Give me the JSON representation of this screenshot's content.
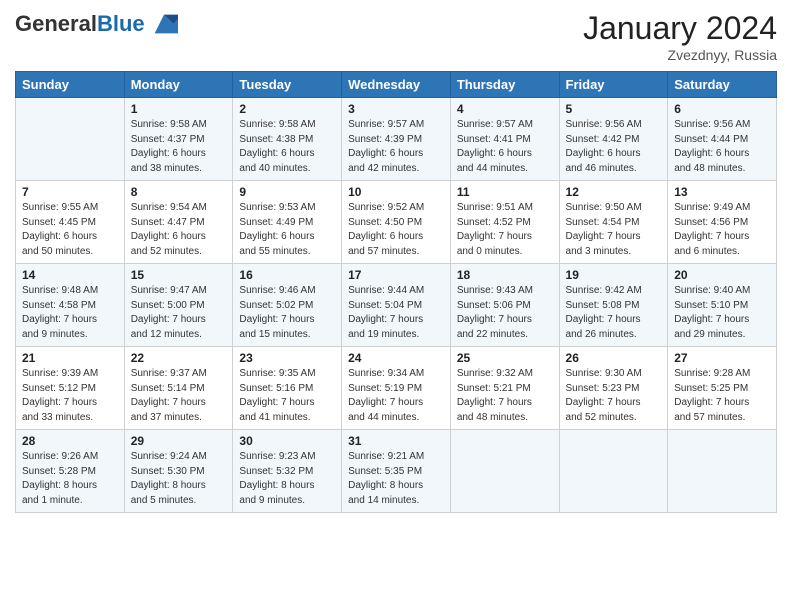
{
  "header": {
    "logo_line1": "General",
    "logo_line2": "Blue",
    "month_year": "January 2024",
    "location": "Zvezdnyy, Russia"
  },
  "days_of_week": [
    "Sunday",
    "Monday",
    "Tuesday",
    "Wednesday",
    "Thursday",
    "Friday",
    "Saturday"
  ],
  "weeks": [
    [
      {
        "day": "",
        "info": ""
      },
      {
        "day": "1",
        "info": "Sunrise: 9:58 AM\nSunset: 4:37 PM\nDaylight: 6 hours\nand 38 minutes."
      },
      {
        "day": "2",
        "info": "Sunrise: 9:58 AM\nSunset: 4:38 PM\nDaylight: 6 hours\nand 40 minutes."
      },
      {
        "day": "3",
        "info": "Sunrise: 9:57 AM\nSunset: 4:39 PM\nDaylight: 6 hours\nand 42 minutes."
      },
      {
        "day": "4",
        "info": "Sunrise: 9:57 AM\nSunset: 4:41 PM\nDaylight: 6 hours\nand 44 minutes."
      },
      {
        "day": "5",
        "info": "Sunrise: 9:56 AM\nSunset: 4:42 PM\nDaylight: 6 hours\nand 46 minutes."
      },
      {
        "day": "6",
        "info": "Sunrise: 9:56 AM\nSunset: 4:44 PM\nDaylight: 6 hours\nand 48 minutes."
      }
    ],
    [
      {
        "day": "7",
        "info": "Sunrise: 9:55 AM\nSunset: 4:45 PM\nDaylight: 6 hours\nand 50 minutes."
      },
      {
        "day": "8",
        "info": "Sunrise: 9:54 AM\nSunset: 4:47 PM\nDaylight: 6 hours\nand 52 minutes."
      },
      {
        "day": "9",
        "info": "Sunrise: 9:53 AM\nSunset: 4:49 PM\nDaylight: 6 hours\nand 55 minutes."
      },
      {
        "day": "10",
        "info": "Sunrise: 9:52 AM\nSunset: 4:50 PM\nDaylight: 6 hours\nand 57 minutes."
      },
      {
        "day": "11",
        "info": "Sunrise: 9:51 AM\nSunset: 4:52 PM\nDaylight: 7 hours\nand 0 minutes."
      },
      {
        "day": "12",
        "info": "Sunrise: 9:50 AM\nSunset: 4:54 PM\nDaylight: 7 hours\nand 3 minutes."
      },
      {
        "day": "13",
        "info": "Sunrise: 9:49 AM\nSunset: 4:56 PM\nDaylight: 7 hours\nand 6 minutes."
      }
    ],
    [
      {
        "day": "14",
        "info": "Sunrise: 9:48 AM\nSunset: 4:58 PM\nDaylight: 7 hours\nand 9 minutes."
      },
      {
        "day": "15",
        "info": "Sunrise: 9:47 AM\nSunset: 5:00 PM\nDaylight: 7 hours\nand 12 minutes."
      },
      {
        "day": "16",
        "info": "Sunrise: 9:46 AM\nSunset: 5:02 PM\nDaylight: 7 hours\nand 15 minutes."
      },
      {
        "day": "17",
        "info": "Sunrise: 9:44 AM\nSunset: 5:04 PM\nDaylight: 7 hours\nand 19 minutes."
      },
      {
        "day": "18",
        "info": "Sunrise: 9:43 AM\nSunset: 5:06 PM\nDaylight: 7 hours\nand 22 minutes."
      },
      {
        "day": "19",
        "info": "Sunrise: 9:42 AM\nSunset: 5:08 PM\nDaylight: 7 hours\nand 26 minutes."
      },
      {
        "day": "20",
        "info": "Sunrise: 9:40 AM\nSunset: 5:10 PM\nDaylight: 7 hours\nand 29 minutes."
      }
    ],
    [
      {
        "day": "21",
        "info": "Sunrise: 9:39 AM\nSunset: 5:12 PM\nDaylight: 7 hours\nand 33 minutes."
      },
      {
        "day": "22",
        "info": "Sunrise: 9:37 AM\nSunset: 5:14 PM\nDaylight: 7 hours\nand 37 minutes."
      },
      {
        "day": "23",
        "info": "Sunrise: 9:35 AM\nSunset: 5:16 PM\nDaylight: 7 hours\nand 41 minutes."
      },
      {
        "day": "24",
        "info": "Sunrise: 9:34 AM\nSunset: 5:19 PM\nDaylight: 7 hours\nand 44 minutes."
      },
      {
        "day": "25",
        "info": "Sunrise: 9:32 AM\nSunset: 5:21 PM\nDaylight: 7 hours\nand 48 minutes."
      },
      {
        "day": "26",
        "info": "Sunrise: 9:30 AM\nSunset: 5:23 PM\nDaylight: 7 hours\nand 52 minutes."
      },
      {
        "day": "27",
        "info": "Sunrise: 9:28 AM\nSunset: 5:25 PM\nDaylight: 7 hours\nand 57 minutes."
      }
    ],
    [
      {
        "day": "28",
        "info": "Sunrise: 9:26 AM\nSunset: 5:28 PM\nDaylight: 8 hours\nand 1 minute."
      },
      {
        "day": "29",
        "info": "Sunrise: 9:24 AM\nSunset: 5:30 PM\nDaylight: 8 hours\nand 5 minutes."
      },
      {
        "day": "30",
        "info": "Sunrise: 9:23 AM\nSunset: 5:32 PM\nDaylight: 8 hours\nand 9 minutes."
      },
      {
        "day": "31",
        "info": "Sunrise: 9:21 AM\nSunset: 5:35 PM\nDaylight: 8 hours\nand 14 minutes."
      },
      {
        "day": "",
        "info": ""
      },
      {
        "day": "",
        "info": ""
      },
      {
        "day": "",
        "info": ""
      }
    ]
  ]
}
